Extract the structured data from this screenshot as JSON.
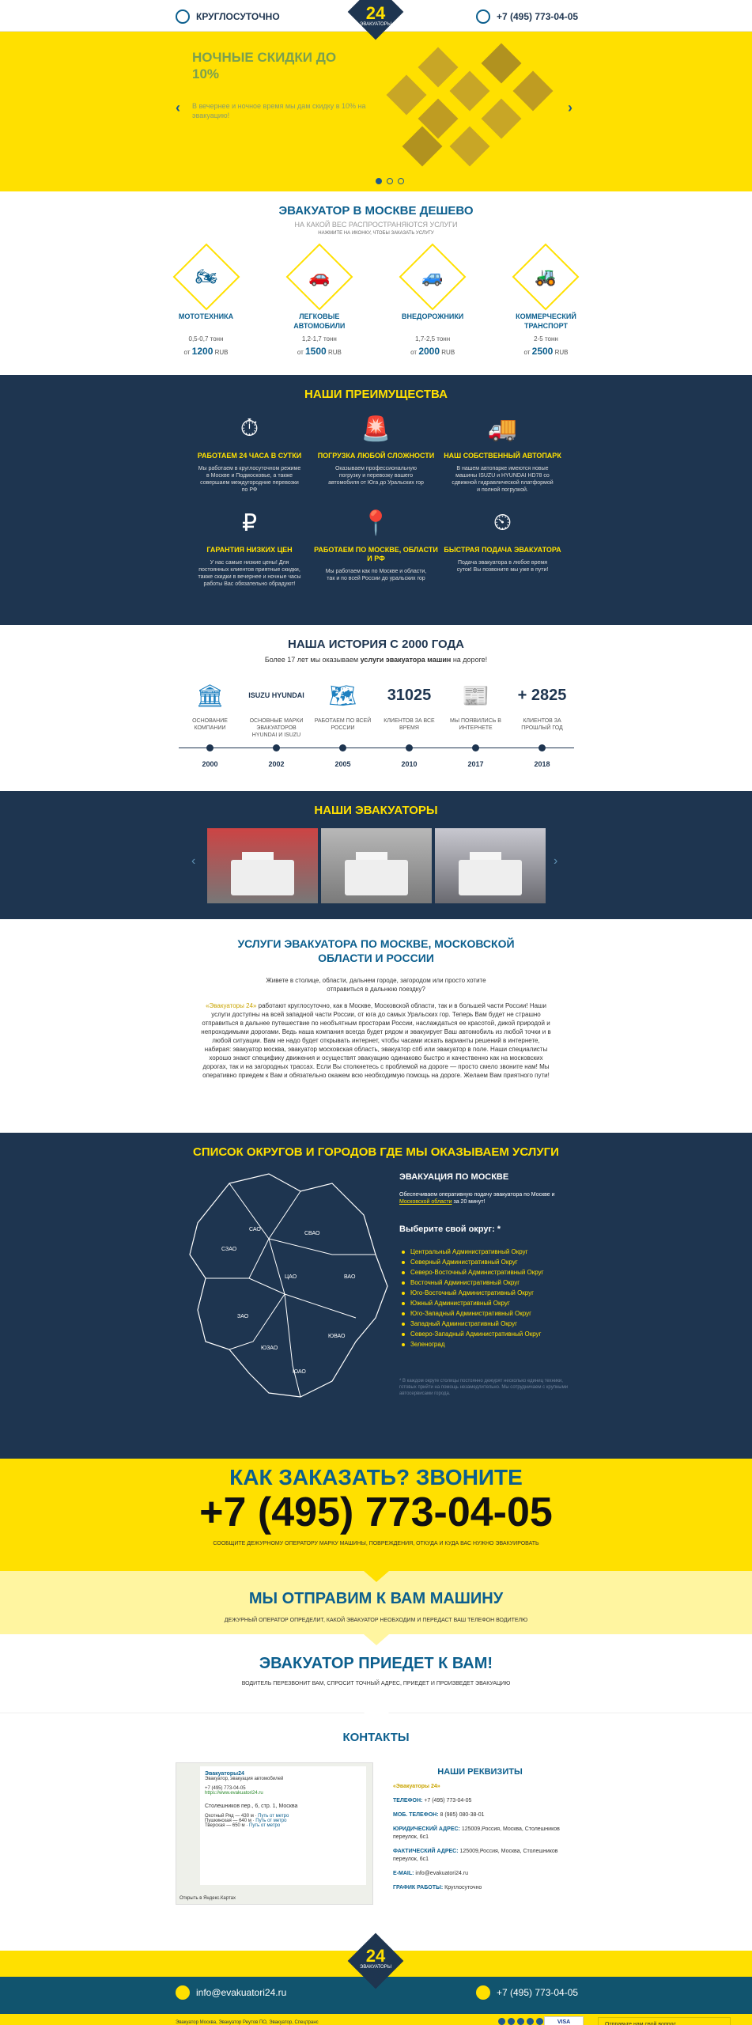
{
  "header": {
    "left_text": "КРУГЛОСУТОЧНО",
    "phone": "+7 (495) 773-04-05",
    "logo_num": "24",
    "logo_sub": "ЭВАКУАТОРЫ"
  },
  "slider": {
    "title": "НОЧНЫЕ СКИДКИ ДО 10%",
    "text": "В вечернее и ночное время мы дам скидку в 10% на эвакуацию!",
    "prev": "‹",
    "next": "›"
  },
  "cheap": {
    "title": "ЭВАКУАТОР В МОСКВЕ ДЕШЕВО",
    "subtitle": "НА КАКОЙ ВЕС РАСПРОСТРАНЯЮТСЯ УСЛУГИ",
    "hint": "НАЖМИТЕ НА ИКОНКУ, ЧТОБЫ ЗАКАЗАТЬ УСЛУГУ",
    "items": [
      {
        "name": "МОТОТЕХНИКА",
        "weight": "0,5-0,7 тонн",
        "from": "от",
        "price": "1200",
        "cur": "RUB",
        "icon": "atv-icon",
        "glyph": "🏍"
      },
      {
        "name": "ЛЕГКОВЫЕ АВТОМОБИЛИ",
        "weight": "1,2-1,7 тонн",
        "from": "от",
        "price": "1500",
        "cur": "RUB",
        "icon": "car-icon",
        "glyph": "🚗"
      },
      {
        "name": "ВНЕДОРОЖНИКИ",
        "weight": "1,7-2,5 тонн",
        "from": "от",
        "price": "2000",
        "cur": "RUB",
        "icon": "suv-icon",
        "glyph": "🚙"
      },
      {
        "name": "КОММЕРЧЕСКИЙ ТРАНСПОРТ",
        "weight": "2-5 тонн",
        "from": "от",
        "price": "2500",
        "cur": "RUB",
        "icon": "tractor-icon",
        "glyph": "🚜"
      }
    ]
  },
  "advantages": {
    "title": "НАШИ ПРЕИМУЩЕСТВА",
    "items": [
      {
        "title": "РАБОТАЕМ 24 ЧАСА В СУТКИ",
        "text": "Мы работаем в круглосуточном режиме в Москве и Подмосковье, а также совершаем междугородние перевозки по РФ",
        "glyph": "⏱",
        "icon": "clock-icon"
      },
      {
        "title": "ПОГРУЗКА ЛЮБОЙ СЛОЖНОСТИ",
        "text": "Оказываем профессиональную погрузку и перевозку вашего автомобиля от Юга до Уральских гор",
        "glyph": "🚨",
        "icon": "loading-icon"
      },
      {
        "title": "НАШ СОБСТВЕННЫЙ АВТОПАРК",
        "text": "В нашем автопарке имеются новые машины ISUZU и HYUNDAI HD78 со сдвижной гидравлической платформой и полной погрузкой.",
        "glyph": "🚚",
        "icon": "truck-icon"
      },
      {
        "title": "ГАРАНТИЯ НИЗКИХ ЦЕН",
        "text": "У нас самые низкие цены! Для постоянных клиентов приятные скидки, также скидки в вечернее и ночные часы работы Вас обязательно обрадуют!",
        "glyph": "₽",
        "icon": "ruble-icon"
      },
      {
        "title": "РАБОТАЕМ ПО МОСКВЕ, ОБЛАСТИ И РФ",
        "text": "Мы работаем как по Москве и области, так и по всей России до уральских гор",
        "glyph": "📍",
        "icon": "map-pin-icon"
      },
      {
        "title": "БЫСТРАЯ ПОДАЧА ЭВАКУАТОРА",
        "text": "Подача эвакуатора в любое время суток! Вы позвоните мы уже в пути!",
        "glyph": "⏲",
        "icon": "stopwatch-icon"
      }
    ]
  },
  "history": {
    "title": "НАША ИСТОРИЯ С 2000 ГОДА",
    "lead_pre": "Более 17 лет мы оказываем ",
    "lead_bold": "услуги эвакуатора машин",
    "lead_post": " на дороге!",
    "items": [
      {
        "kind": "icon",
        "glyph": "🏛",
        "label": "ОСНОВАНИЕ КОМПАНИИ",
        "year": "2000",
        "icon": "building-icon"
      },
      {
        "kind": "brand",
        "big": "ISUZU HYUNDAI",
        "label": "ОСНОВНЫЕ МАРКИ ЭВАКУАТОРОВ HYUNDAI И ISUZU",
        "year": "2002",
        "icon": "brands-logo"
      },
      {
        "kind": "icon",
        "glyph": "🗺",
        "label": "РАБОТАЕМ ПО ВСЕЙ РОССИИ",
        "year": "2005",
        "icon": "russia-map-icon"
      },
      {
        "kind": "num",
        "big": "31025",
        "label": "КЛИЕНТОВ ЗА ВСЕ ВРЕМЯ",
        "year": "2010",
        "icon": ""
      },
      {
        "kind": "icon",
        "glyph": "📰",
        "label": "МЫ ПОЯВИЛИСЬ В ИНТЕРНЕТЕ",
        "year": "2017",
        "icon": "browser-icon"
      },
      {
        "kind": "num",
        "big": "+ 2825",
        "label": "КЛИЕНТОВ ЗА ПРОШЛЫЙ ГОД",
        "year": "2018",
        "icon": ""
      }
    ]
  },
  "trucks": {
    "title": "НАШИ ЭВАКУАТОРЫ"
  },
  "services": {
    "title": "УСЛУГИ ЭВАКУАТОРА ПО МОСКВЕ, МОСКОВСКОЙ ОБЛАСТИ И РОССИИ",
    "intro": "Живете в столице, области, дальнем городе, загородом или просто хотите отправиться в дальнюю поездку?",
    "body_link": "«Эвакуаторы 24»",
    "body": " работают круглосуточно, как в Москве, Московской области, так и в большей части России! Наши услуги доступны на всей западной части России, от юга до самых Уральских гор. Теперь Вам будет не страшно отправиться в дальнее путешествие по необъятным просторам России, наслаждаться ее красотой, дикой природой и непроходимыми дорогами. Ведь наша компания всегда будет рядом и эвакуирует Ваш автомобиль из любой точки и в любой ситуации. Вам не надо будет открывать интернет, чтобы часами искать варианты решений в интернете, набирая: эвакуатор москва, эвакуатор московская область, эвакуатор спб или эвакуатор в поле. Наши специалисты хорошо знают специфику движения и осуществят эвакуацию одинаково быстро и качественно как на московских дорогах, так и на загородных трассах. Если Вы столкнетесь с проблемой на дороге — просто смело звоните нам! Мы оперативно приедем к Вам и обязательно окажем всю необходимую помощь на дороге. Желаем Вам приятного пути!"
  },
  "districts": {
    "title": "СПИСОК ОКРУГОВ И ГОРОДОВ ГДЕ МЫ ОКАЗЫВАЕМ УСЛУГИ",
    "sub": "ЭВАКУАЦИЯ ПО МОСКВЕ",
    "desc_pre": "Обеспечиваем оперативную подачу эвакуатора по Москве и ",
    "desc_link": "Московской области",
    "desc_post": " за 20 минут!",
    "choose": "Выберите свой округ: *",
    "labels": [
      "САО",
      "СВАО",
      "СЗАО",
      "ВАО",
      "ЦАО",
      "ЗАО",
      "ЮЗАО",
      "ЮВАО",
      "ЮАО"
    ],
    "list": [
      "Центральный Административный Округ",
      "Северный Административный Округ",
      "Северо-Восточный Административный Округ",
      "Восточный Административный Округ",
      "Юго-Восточный Административный Округ",
      "Южный Административный Округ",
      "Юго-Западный Административный Округ",
      "Западный Административный Округ",
      "Северо-Западный Административный Округ",
      "Зеленоград"
    ],
    "fine": "* В каждом округе столицы постоянно дежурят несколько единиц техники, готовых прийти на помощь незамедлительно. Мы сотрудничаем с крупными автосервисами города."
  },
  "call": {
    "title": "КАК ЗАКАЗАТЬ? ЗВОНИТЕ",
    "phone": "+7 (495) 773-04-05",
    "cap": "СООБЩИТЕ ДЕЖУРНОМУ ОПЕРАТОРУ МАРКУ МАШИНЫ, ПОВРЕЖДЕНИЯ, ОТКУДА И КУДА ВАС НУЖНО ЭВАКУИРОВАТЬ"
  },
  "send": {
    "title": "МЫ ОТПРАВИМ К ВАМ МАШИНУ",
    "cap": "ДЕЖУРНЫЙ ОПЕРАТОР ОПРЕДЕЛИТ, КАКОЙ ЭВАКУАТОР НЕОБХОДИМ И ПЕРЕДАСТ ВАШ ТЕЛЕФОН ВОДИТЕЛЮ"
  },
  "arrive": {
    "title": "ЭВАКУАТОР ПРИЕДЕТ К ВАМ!",
    "cap": "ВОДИТЕЛЬ ПЕРЕЗВОНИТ ВАМ, СПРОСИТ ТОЧНЫЙ АДРЕС, ПРИЕДЕТ И ПРОИЗВЕДЕТ ЭВАКУАЦИЮ"
  },
  "contacts": {
    "title": "КОНТАКТЫ",
    "map": {
      "name": "Эвакуаторы24",
      "desc": "Эвакуатор, эвакуация автомобилей",
      "phone": "+7 (495) 773-04-05",
      "site": "https://www.evakuatori24.ru",
      "addr": "Столешников пер., 6, стр. 1, Москва",
      "m1": "Охотный Ряд — 430 м",
      "m2": "Пушкинская — 640 м",
      "m3": "Тверская — 650 м",
      "route": "Путь от метро",
      "open": "Открыть в Яндекс.Картах"
    },
    "req_title": "НАШИ РЕКВИЗИТЫ",
    "company": "«Эвакуаторы 24»",
    "rows": [
      {
        "k": "ТЕЛЕФОН:",
        "v": "+7 (495) 773-04-05"
      },
      {
        "k": "МОБ. ТЕЛЕФОН:",
        "v": "8 (985) 080-38-01"
      },
      {
        "k": "ЮРИДИЧЕСКИЙ АДРЕС:",
        "v": "125009,Россия, Москва, Столешников переулок, 6с1"
      },
      {
        "k": "ФАКТИЧЕСКИЙ АДРЕС:",
        "v": "125009,Россия, Москва, Столешников переулок, 6с1"
      },
      {
        "k": "E-MAIL:",
        "v": "info@evakuatori24.ru"
      },
      {
        "k": "ГРАФИК РАБОТЫ:",
        "v": "Круглосуточно"
      }
    ]
  },
  "footer": {
    "email": "info@evakuatori24.ru",
    "phone": "+7 (495) 773-04-05",
    "logo_num": "24",
    "logo_sub": "ЭВАКУАТОРЫ",
    "links": "Эвакуатор Москва, Эвакуатор Реутов ПО, Эвакуатор, Спецтранс",
    "pay": "VISA",
    "chat": "Отправьте нам свой вопрос"
  }
}
